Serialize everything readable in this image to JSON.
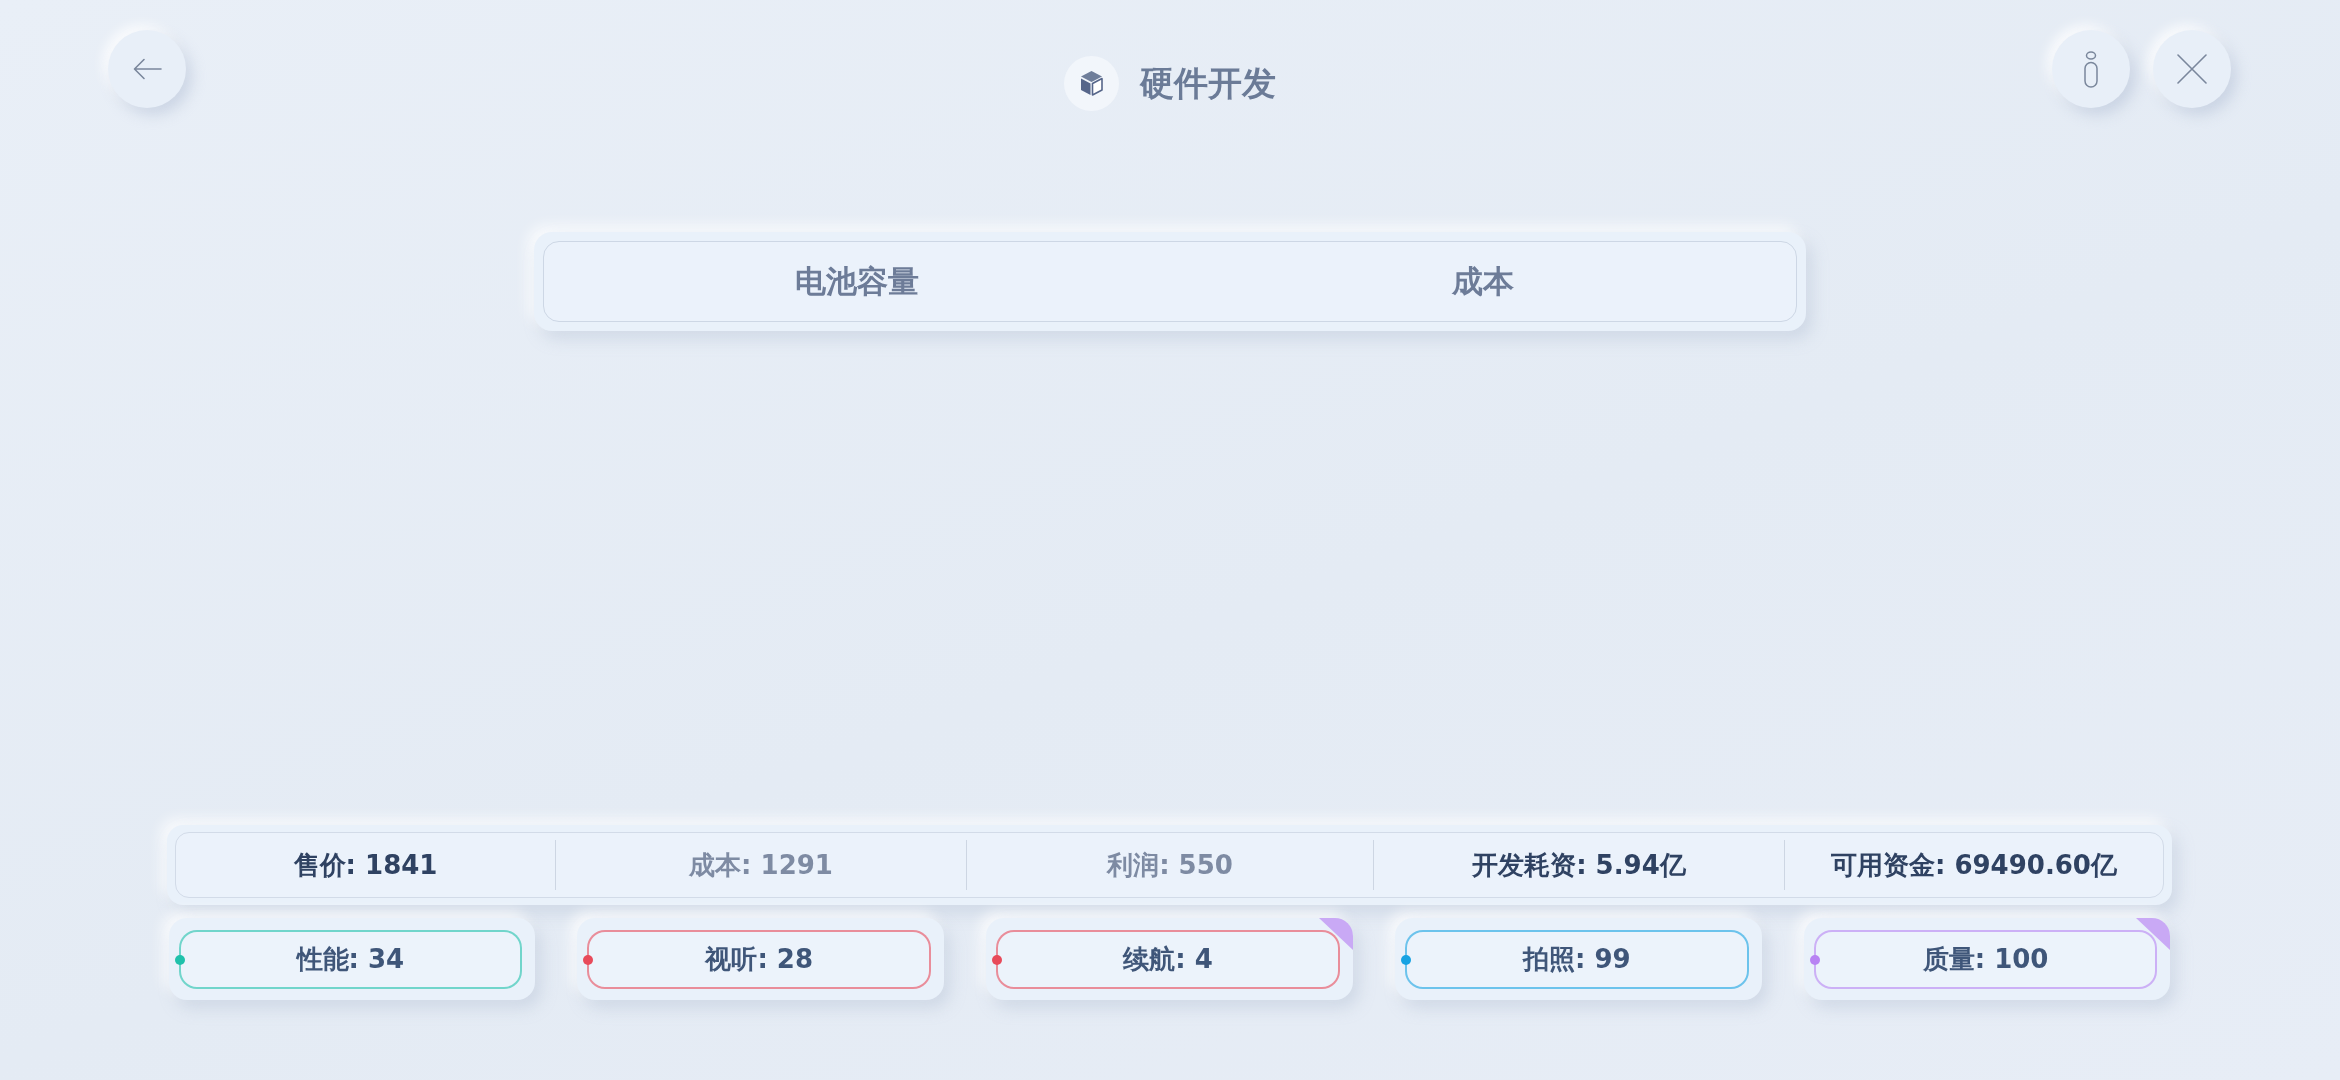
{
  "header": {
    "title": "硬件开发"
  },
  "options_table": {
    "columns": [
      "电池容量",
      "成本"
    ]
  },
  "summary": [
    {
      "text": "售价: 1841",
      "dimmed": false
    },
    {
      "text": "成本: 1291",
      "dimmed": true
    },
    {
      "text": "利润: 550",
      "dimmed": true
    },
    {
      "text": "开发耗资: 5.94亿",
      "dimmed": false
    },
    {
      "text": "可用资金: 69490.60亿",
      "dimmed": false
    }
  ],
  "attributes": [
    {
      "label": "性能: 34",
      "color": "#1fc1ab",
      "flagged": false
    },
    {
      "label": "视听: 28",
      "color": "#e84a5a",
      "flagged": false
    },
    {
      "label": "续航: 4",
      "color": "#e84a5a",
      "flagged": true
    },
    {
      "label": "拍照: 99",
      "color": "#17a3e3",
      "flagged": false
    },
    {
      "label": "质量: 100",
      "color": "#b883f3",
      "flagged": true
    }
  ]
}
